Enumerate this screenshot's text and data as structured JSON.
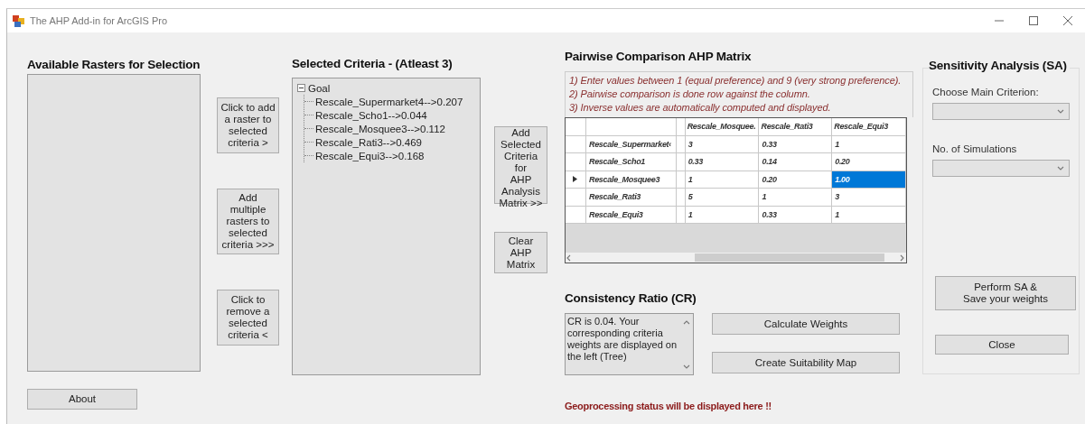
{
  "window": {
    "title": "The AHP Add-in for ArcGIS Pro"
  },
  "available_rasters": {
    "heading": "Available Rasters for Selection"
  },
  "raster_buttons": [
    "Click to add\na raster to\nselected\ncriteria >",
    "Add\nmultiple\nrasters to\nselected\ncriteria >>>",
    "Click to\nremove a\nselected\ncriteria <"
  ],
  "about_button": "About",
  "selected_criteria": {
    "heading": "Selected Criteria - (Atleast 3)",
    "tree": {
      "label": "Goal",
      "expanded": true,
      "children": [
        {
          "label": "Rescale_Supermarket4-->0.207"
        },
        {
          "label": "Rescale_Scho1-->0.044"
        },
        {
          "label": "Rescale_Mosquee3-->0.112"
        },
        {
          "label": "Rescale_Rati3-->0.469"
        },
        {
          "label": "Rescale_Equi3-->0.168"
        }
      ]
    }
  },
  "matrix_buttons": [
    "Add\nSelected\nCriteria for\nAHP\nAnalysis\nMatrix >>",
    "Clear\nAHP\nMatrix"
  ],
  "pairwise": {
    "heading": "Pairwise Comparison AHP Matrix",
    "instructions": [
      "1) Enter values between 1 (equal preference) and  9 (very strong preference).",
      "2) Pairwise comparison is done row against the column.",
      "3) Inverse values are automatically computed and displayed."
    ],
    "columns": [
      "Rescale_Mosquee.",
      "Rescale_Rati3",
      "Rescale_Equi3"
    ],
    "rows": [
      {
        "name": "Rescale_Supermarket‹",
        "current": false,
        "cells": [
          {
            "value": "3",
            "selected": false
          },
          {
            "value": "0.33",
            "selected": false
          },
          {
            "value": "1",
            "selected": false
          }
        ]
      },
      {
        "name": "Rescale_Scho1",
        "current": false,
        "cells": [
          {
            "value": "0.33",
            "selected": false
          },
          {
            "value": "0.14",
            "selected": false
          },
          {
            "value": "0.20",
            "selected": false
          }
        ]
      },
      {
        "name": "Rescale_Mosquee3",
        "current": true,
        "cells": [
          {
            "value": "1",
            "selected": false
          },
          {
            "value": "0.20",
            "selected": false
          },
          {
            "value": "1.00",
            "selected": true
          }
        ]
      },
      {
        "name": "Rescale_Rati3",
        "current": false,
        "cells": [
          {
            "value": "5",
            "selected": false
          },
          {
            "value": "1",
            "selected": false
          },
          {
            "value": "3",
            "selected": false
          }
        ]
      },
      {
        "name": "Rescale_Equi3",
        "current": false,
        "cells": [
          {
            "value": "1",
            "selected": false
          },
          {
            "value": "0.33",
            "selected": false
          },
          {
            "value": "1",
            "selected": false
          }
        ]
      }
    ]
  },
  "consistency": {
    "heading": "Consistency Ratio (CR)",
    "text": "CR is 0.04. Your corresponding criteria weights are displayed on the left (Tree)",
    "buttons": [
      "Calculate Weights",
      "Create Suitability Map"
    ]
  },
  "status": "Geoprocessing status will be displayed here !!",
  "sensitivity": {
    "heading": "Sensitivity Analysis (SA)",
    "fields": [
      {
        "label": "Choose Main Criterion:"
      },
      {
        "label": "No. of Simulations"
      }
    ],
    "buttons": [
      "Perform SA &\nSave your weights",
      "Close"
    ]
  }
}
